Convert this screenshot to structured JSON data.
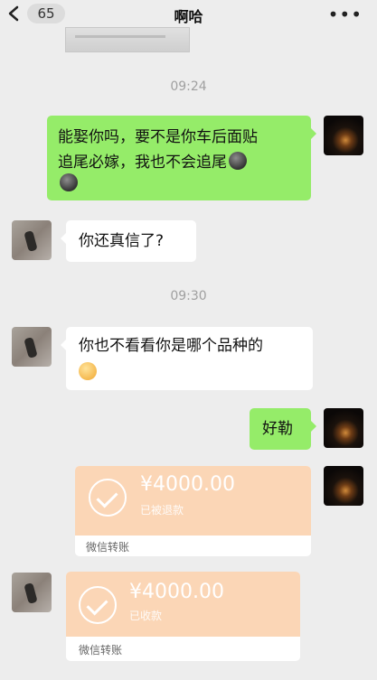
{
  "header": {
    "back_count": "65",
    "title": "啊哈",
    "more": "•••"
  },
  "messages": {
    "time1": "09:24",
    "msg1_line1": "能娶你吗，要不是你车后面贴",
    "msg1_line2": "追尾必嫁，我也不会追尾",
    "msg2": "你还真信了?",
    "time2": "09:30",
    "msg3": "你也不看看你是哪个品种的",
    "msg4": "好勒",
    "transfer1": {
      "amount": "¥4000.00",
      "status": "已被退款",
      "label": "微信转账"
    },
    "transfer2": {
      "amount": "¥4000.00",
      "status": "已收款",
      "label": "微信转账"
    }
  },
  "colors": {
    "background": "#ededed",
    "green_bubble": "#95ec69",
    "transfer_card": "#fbd6b6"
  }
}
